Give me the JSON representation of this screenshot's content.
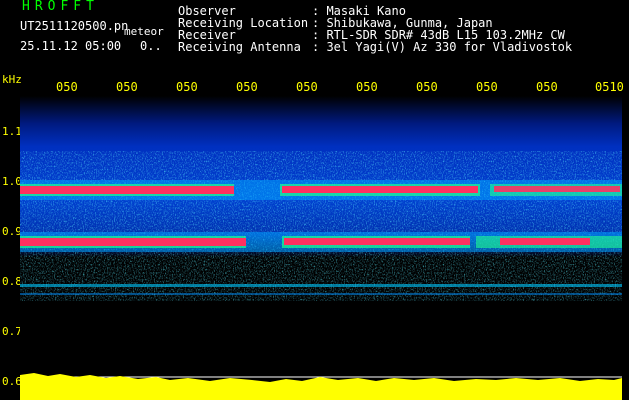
{
  "header": {
    "logo": "HROFFT",
    "file_name": "UT2511120500.pn",
    "meteor_label": "meteor",
    "datetime": "25.11.12 05:00",
    "meteor_count": "0..",
    "info": [
      {
        "label": "Observer",
        "value": ": Masaki Kano"
      },
      {
        "label": "Receiving Location",
        "value": ": Shibukawa, Gunma, Japan"
      },
      {
        "label": "Receiver",
        "value": ": RTL-SDR SDR# 43dB L15 103.2MHz CW"
      },
      {
        "label": "Receiving Antenna",
        "value": ": 3el Yagi(V) Az 330 for Vladivostok"
      }
    ]
  },
  "axis": {
    "unit": "kHz",
    "x_ticks": [
      "050",
      "050",
      "050",
      "050",
      "050",
      "050",
      "050",
      "050",
      "050",
      "0510"
    ],
    "y_ticks": [
      "1.1",
      "1.0",
      "0.9",
      "0.8",
      "0.7",
      "0.6"
    ]
  },
  "colors": {
    "background": "#000000",
    "text_header": "#ffffff",
    "text_logo": "#00ff00",
    "axis": "#ffff00",
    "signal_hot": "#ff3060",
    "signal_mid": "#00ffa0",
    "noise": "#0030c0",
    "meter": "#ffff00"
  }
}
